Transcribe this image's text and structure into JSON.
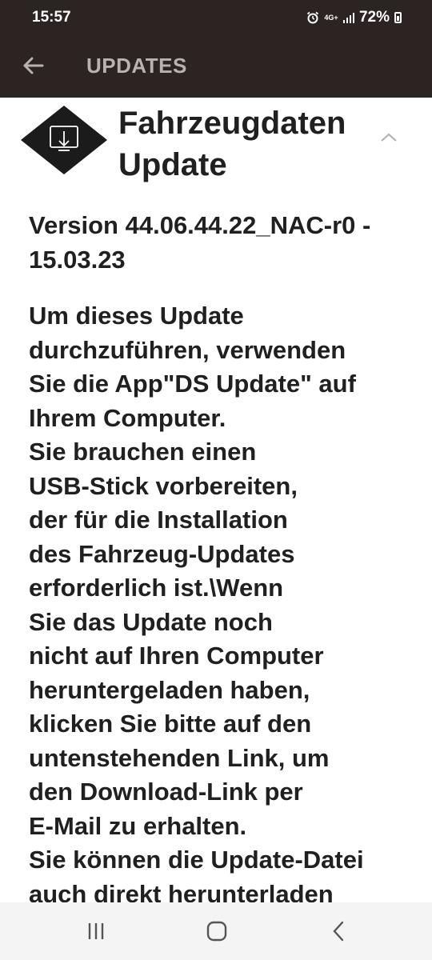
{
  "status_bar": {
    "time": "15:57",
    "network": "4G+",
    "battery": "72%",
    "icons": [
      "alarm-icon",
      "network-icon",
      "signal-icon",
      "battery-icon"
    ]
  },
  "app_bar": {
    "title": "UPDATES",
    "back_icon": "arrow-left-icon"
  },
  "update": {
    "title": "Fahrzeugdaten Update",
    "icon": "download-diamond-icon",
    "toggle_icon": "chevron-up-icon",
    "version": "Version 44.06.44.22_NAC-r0 - 15.03.23",
    "description": "Um dieses Update\ndurchzuführen, verwenden\nSie die App\"DS Update\" auf\nIhrem Computer.\nSie brauchen einen\nUSB-Stick vorbereiten,\nder für die Installation\ndes Fahrzeug-Updates\nerforderlich ist.\\Wenn\nSie das Update noch\nnicht auf Ihren Computer\nheruntergeladen haben,\nklicken Sie bitte auf den\nuntenstehenden Link, um\nden Download-Link per\nE-Mail zu erhalten.\nSie können die Update-Datei\nauch direkt herunterladen"
  },
  "nav_bar": {
    "items": [
      "recents-icon",
      "home-icon",
      "back-icon"
    ]
  },
  "colors": {
    "app_bar_bg": "#2b2422",
    "title_color": "#b9b3ad",
    "text": "#202020",
    "nav_bg": "#f4f4f4"
  }
}
